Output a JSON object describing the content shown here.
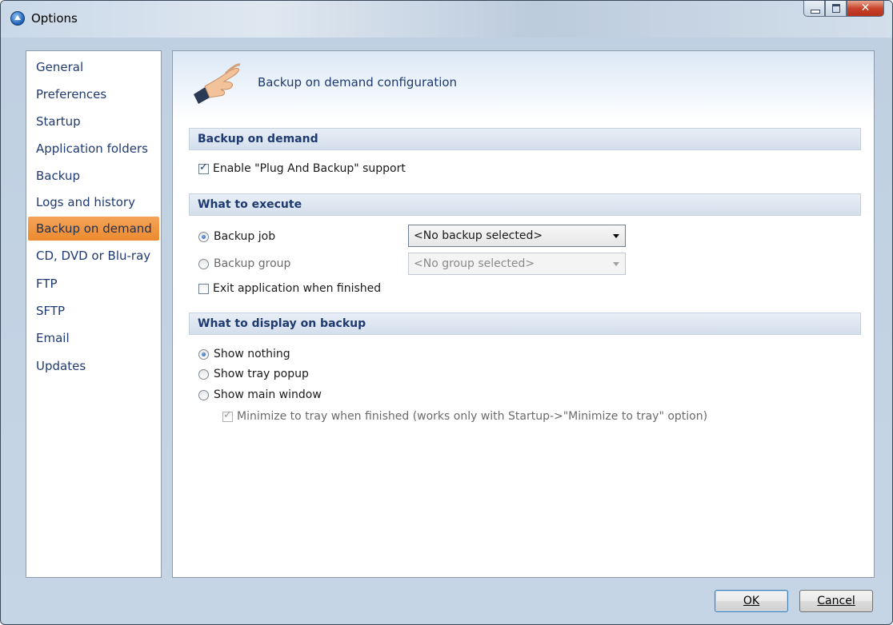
{
  "window": {
    "title": "Options"
  },
  "sidebar": {
    "items": [
      {
        "label": "General"
      },
      {
        "label": "Preferences"
      },
      {
        "label": "Startup"
      },
      {
        "label": "Application folders"
      },
      {
        "label": "Backup"
      },
      {
        "label": "Logs and history"
      },
      {
        "label": "Backup on demand",
        "selected": true
      },
      {
        "label": "CD, DVD or Blu-ray"
      },
      {
        "label": "FTP"
      },
      {
        "label": "SFTP"
      },
      {
        "label": "Email"
      },
      {
        "label": "Updates"
      }
    ]
  },
  "content": {
    "header_title": "Backup on demand configuration",
    "sections": {
      "backup_on_demand": "Backup on demand",
      "what_to_execute": "What to execute",
      "what_to_display": "What to display on backup"
    },
    "enable_plug": {
      "label": "Enable \"Plug And Backup\" support",
      "checked": true
    },
    "execute": {
      "backup_job": {
        "label": "Backup job",
        "selected": true
      },
      "backup_group": {
        "label": "Backup group",
        "selected": false
      },
      "job_combo": "<No backup selected>",
      "group_combo": "<No group selected>",
      "exit_app": {
        "label": "Exit application when finished",
        "checked": false
      }
    },
    "display": {
      "show_nothing": {
        "label": "Show nothing",
        "selected": true
      },
      "show_tray": {
        "label": "Show tray popup",
        "selected": false
      },
      "show_main": {
        "label": "Show main window",
        "selected": false
      },
      "minimize": {
        "label": "Minimize to tray when finished (works only with Startup->\"Minimize to tray\" option)",
        "checked": true,
        "disabled": true
      }
    }
  },
  "buttons": {
    "ok": "OK",
    "cancel": "Cancel"
  },
  "colors": {
    "selected_item": "#ec8a2f",
    "link_text": "#1f3a70"
  }
}
